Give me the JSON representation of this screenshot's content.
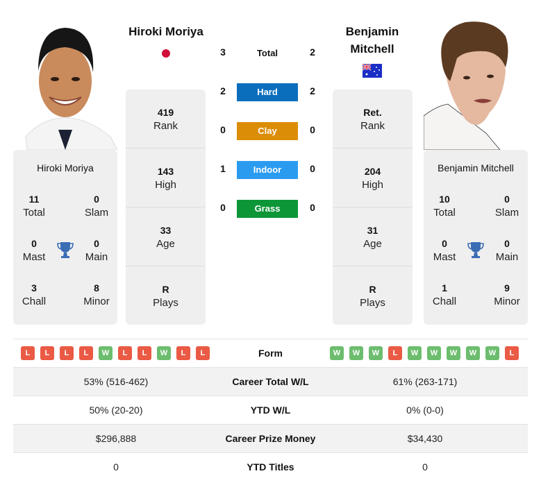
{
  "player1": {
    "name": "Hiroki Moriya",
    "country": "Japan",
    "flag_icon": "japan-flag-icon",
    "rank": {
      "value": "419",
      "label": "Rank"
    },
    "high": {
      "value": "143",
      "label": "High"
    },
    "age": {
      "value": "33",
      "label": "Age"
    },
    "plays": {
      "value": "R",
      "label": "Plays"
    },
    "titles": {
      "total": {
        "value": "11",
        "label": "Total"
      },
      "slam": {
        "value": "0",
        "label": "Slam"
      },
      "mast": {
        "value": "0",
        "label": "Mast"
      },
      "main": {
        "value": "0",
        "label": "Main"
      },
      "chall": {
        "value": "3",
        "label": "Chall"
      },
      "minor": {
        "value": "8",
        "label": "Minor"
      }
    },
    "form": [
      "L",
      "L",
      "L",
      "L",
      "W",
      "L",
      "L",
      "W",
      "L",
      "L"
    ],
    "career_wl": "53% (516-462)",
    "ytd_wl": "50% (20-20)",
    "prize_money": "$296,888",
    "ytd_titles": "0"
  },
  "player2": {
    "name_line1": "Benjamin",
    "name_line2": "Mitchell",
    "name": "Benjamin Mitchell",
    "country": "Australia",
    "flag_icon": "australia-flag-icon",
    "rank": {
      "value": "Ret.",
      "label": "Rank"
    },
    "high": {
      "value": "204",
      "label": "High"
    },
    "age": {
      "value": "31",
      "label": "Age"
    },
    "plays": {
      "value": "R",
      "label": "Plays"
    },
    "titles": {
      "total": {
        "value": "10",
        "label": "Total"
      },
      "slam": {
        "value": "0",
        "label": "Slam"
      },
      "mast": {
        "value": "0",
        "label": "Mast"
      },
      "main": {
        "value": "0",
        "label": "Main"
      },
      "chall": {
        "value": "1",
        "label": "Chall"
      },
      "minor": {
        "value": "9",
        "label": "Minor"
      }
    },
    "form": [
      "W",
      "W",
      "W",
      "L",
      "W",
      "W",
      "W",
      "W",
      "W",
      "L"
    ],
    "career_wl": "61% (263-171)",
    "ytd_wl": "0% (0-0)",
    "prize_money": "$34,430",
    "ytd_titles": "0"
  },
  "h2h": {
    "total": {
      "label": "Total",
      "p1": "3",
      "p2": "2"
    },
    "surfaces": [
      {
        "label": "Hard",
        "p1": "2",
        "p2": "2",
        "color": "#0a6ebd"
      },
      {
        "label": "Clay",
        "p1": "0",
        "p2": "0",
        "color": "#dc8d07"
      },
      {
        "label": "Indoor",
        "p1": "1",
        "p2": "0",
        "color": "#2b9bf0"
      },
      {
        "label": "Grass",
        "p1": "0",
        "p2": "0",
        "color": "#0c9638"
      }
    ]
  },
  "table": {
    "form_label": "Form",
    "career_wl_label": "Career Total W/L",
    "ytd_wl_label": "YTD W/L",
    "prize_label": "Career Prize Money",
    "ytd_titles_label": "YTD Titles"
  }
}
